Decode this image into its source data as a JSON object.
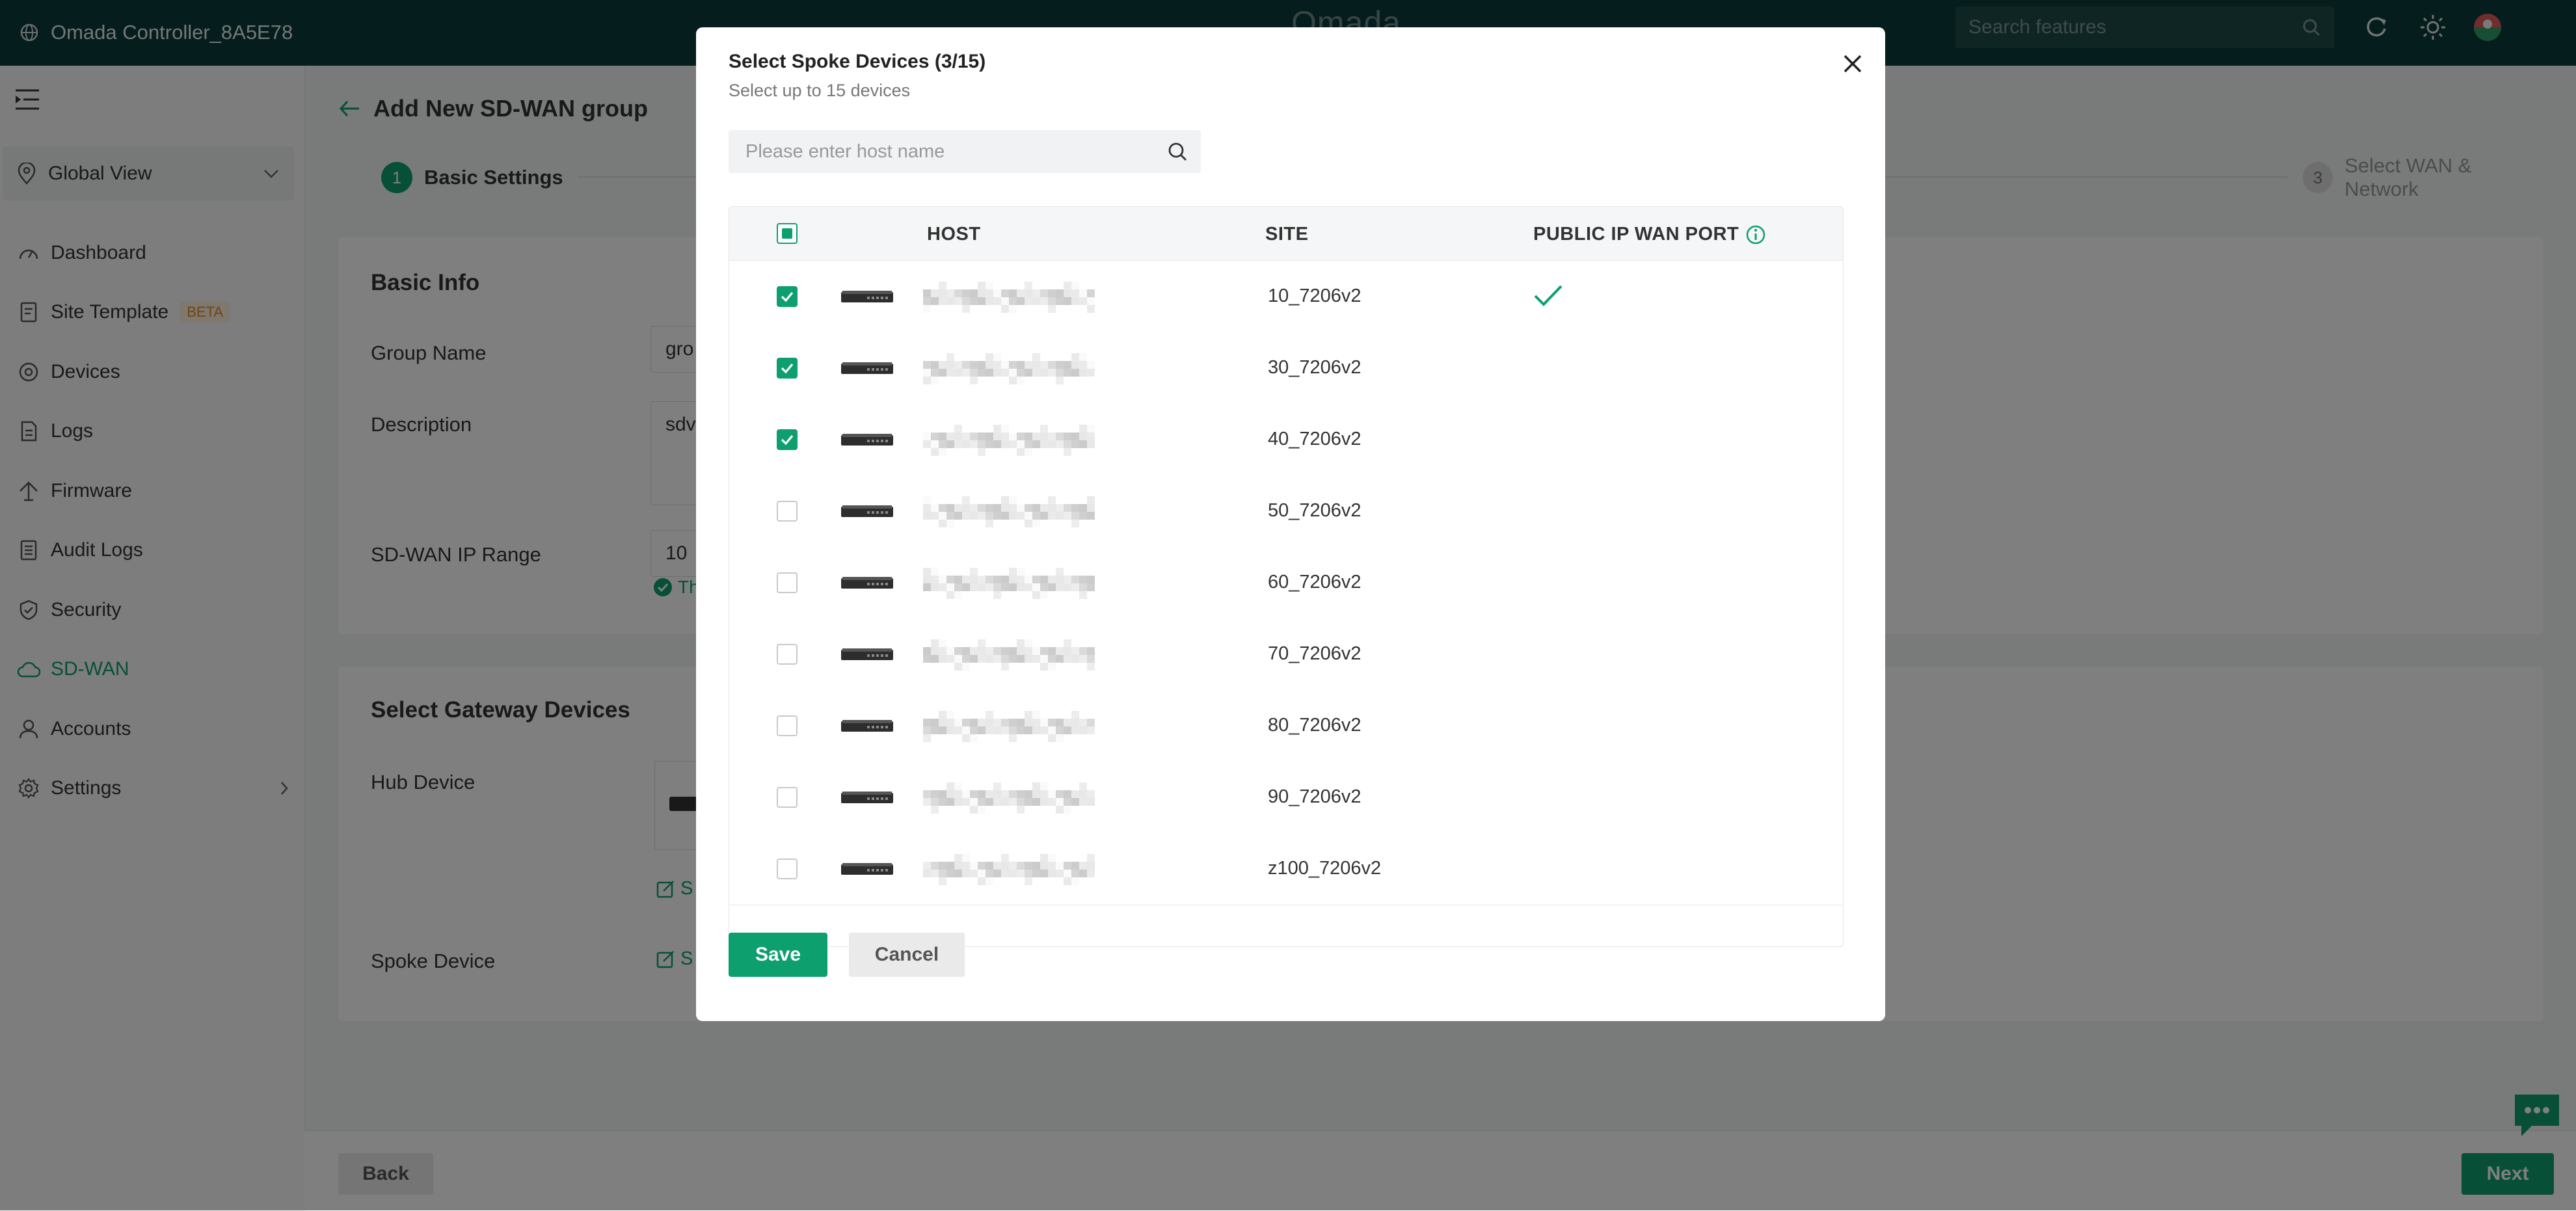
{
  "topbar": {
    "controller_name": "Omada Controller_8A5E78",
    "logo_text": "Omada",
    "search_placeholder": "Search features"
  },
  "sidebar": {
    "scope": "Global View",
    "items": [
      {
        "label": "Dashboard",
        "icon": "dashboard-icon"
      },
      {
        "label": "Site Template",
        "icon": "template-icon",
        "badge": "BETA"
      },
      {
        "label": "Devices",
        "icon": "devices-icon"
      },
      {
        "label": "Logs",
        "icon": "logs-icon"
      },
      {
        "label": "Firmware",
        "icon": "firmware-icon"
      },
      {
        "label": "Audit Logs",
        "icon": "audit-logs-icon"
      },
      {
        "label": "Security",
        "icon": "shield-icon"
      },
      {
        "label": "SD-WAN",
        "icon": "cloud-icon",
        "active": true
      },
      {
        "label": "Accounts",
        "icon": "user-icon"
      },
      {
        "label": "Settings",
        "icon": "gear-icon"
      }
    ]
  },
  "page": {
    "title": "Add New SD-WAN group",
    "steps": [
      {
        "num": "1",
        "label": "Basic Settings",
        "active": true
      },
      {
        "num": "3",
        "label": "Select WAN & Network",
        "active": false
      }
    ],
    "basic_info": {
      "title": "Basic Info",
      "group_name_label": "Group Name",
      "group_name_value": "gro",
      "description_label": "Description",
      "description_value": "sdv",
      "ip_range_label": "SD-WAN IP Range",
      "ip_range_value": "10",
      "ip_range_hint": "Th"
    },
    "gateway": {
      "title": "Select Gateway Devices",
      "hub_label": "Hub Device",
      "hub_link": "S",
      "spoke_label": "Spoke Device",
      "spoke_link": "S"
    },
    "footer": {
      "back": "Back",
      "next": "Next"
    }
  },
  "modal": {
    "title": "Select Spoke Devices (3/15)",
    "subtitle": "Select up to 15 devices",
    "search_placeholder": "Please enter host name",
    "columns": {
      "host": "HOST",
      "site": "SITE",
      "public_ip": "PUBLIC IP WAN PORT"
    },
    "rows": [
      {
        "site": "10_7206v2",
        "checked": true,
        "public_ip": true
      },
      {
        "site": "30_7206v2",
        "checked": true,
        "public_ip": false
      },
      {
        "site": "40_7206v2",
        "checked": true,
        "public_ip": false
      },
      {
        "site": "50_7206v2",
        "checked": false,
        "public_ip": false
      },
      {
        "site": "60_7206v2",
        "checked": false,
        "public_ip": false
      },
      {
        "site": "70_7206v2",
        "checked": false,
        "public_ip": false
      },
      {
        "site": "80_7206v2",
        "checked": false,
        "public_ip": false
      },
      {
        "site": "90_7206v2",
        "checked": false,
        "public_ip": false
      },
      {
        "site": "z100_7206v2",
        "checked": false,
        "public_ip": false
      }
    ],
    "save": "Save",
    "cancel": "Cancel"
  },
  "colors": {
    "accent": "#0e9f6e",
    "topbar": "#0b3b39"
  }
}
